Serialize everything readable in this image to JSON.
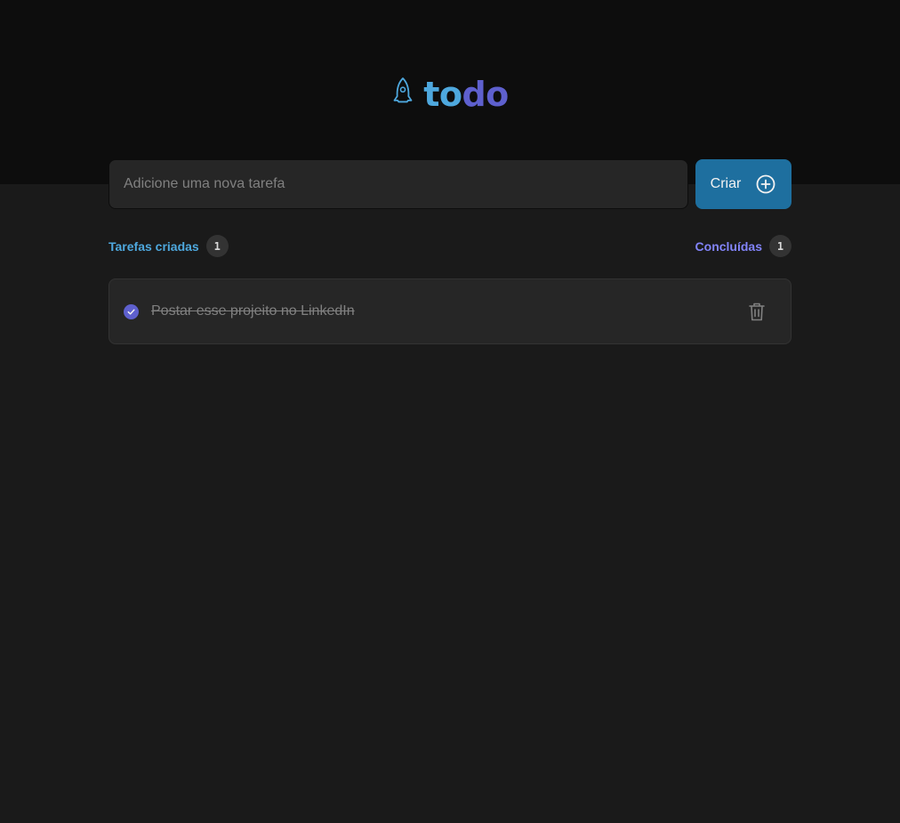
{
  "header": {
    "logo": {
      "icon": "rocket-icon",
      "text_part1": "to",
      "text_part2": "do",
      "color_part1": "#4ea8de",
      "color_part2": "#5e60ce"
    }
  },
  "new_task": {
    "placeholder": "Adicione uma nova tarefa",
    "value": "",
    "create_label": "Criar",
    "create_icon": "plus-circle-icon"
  },
  "info": {
    "created_label": "Tarefas criadas",
    "created_count": "1",
    "done_label": "Concluídas",
    "done_count": "1"
  },
  "tasks": [
    {
      "text": "Postar esse projeito no LinkedIn",
      "completed": true,
      "check_icon": "check-icon",
      "delete_icon": "trash-icon"
    }
  ],
  "colors": {
    "header_bg": "#0d0d0d",
    "body_bg": "#1a1a1a",
    "accent_blue": "#4ea8de",
    "accent_purple": "#8284fa",
    "button_bg": "#1e6f9f"
  }
}
